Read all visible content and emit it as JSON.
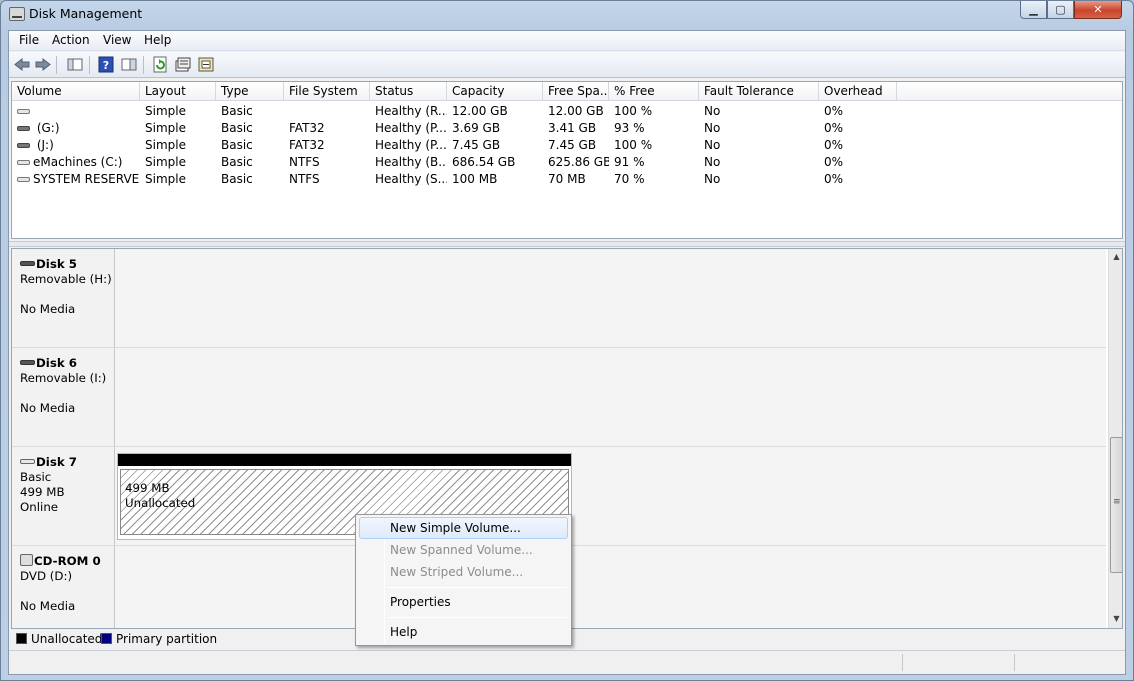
{
  "window": {
    "title": "Disk Management",
    "min_label": "▁",
    "max_label": "▢",
    "close_label": "✕"
  },
  "menu": [
    "File",
    "Action",
    "View",
    "Help"
  ],
  "toolbar": {
    "icons": [
      "back-icon",
      "forward-icon",
      "show-hide-console-tree-icon",
      "help-icon",
      "show-hide-action-pane-icon",
      "refresh-icon",
      "properties-icon",
      "rescan-disks-icon"
    ]
  },
  "volume_list": {
    "columns": [
      "Volume",
      "Layout",
      "Type",
      "File System",
      "Status",
      "Capacity",
      "Free Spa...",
      "% Free",
      "Fault Tolerance",
      "Overhead"
    ],
    "rows": [
      {
        "volume": "",
        "layout": "Simple",
        "type": "Basic",
        "fs": "",
        "status": "Healthy (R...",
        "capacity": "12.00 GB",
        "free": "12.00 GB",
        "pct": "100 %",
        "fault": "No",
        "overhead": "0%"
      },
      {
        "volume": "(G:)",
        "layout": "Simple",
        "type": "Basic",
        "fs": "FAT32",
        "status": "Healthy (P...",
        "capacity": "3.69 GB",
        "free": "3.41 GB",
        "pct": "93 %",
        "fault": "No",
        "overhead": "0%"
      },
      {
        "volume": "(J:)",
        "layout": "Simple",
        "type": "Basic",
        "fs": "FAT32",
        "status": "Healthy (P...",
        "capacity": "7.45 GB",
        "free": "7.45 GB",
        "pct": "100 %",
        "fault": "No",
        "overhead": "0%"
      },
      {
        "volume": "eMachines (C:)",
        "layout": "Simple",
        "type": "Basic",
        "fs": "NTFS",
        "status": "Healthy (B...",
        "capacity": "686.54 GB",
        "free": "625.86 GB",
        "pct": "91 %",
        "fault": "No",
        "overhead": "0%"
      },
      {
        "volume": "SYSTEM RESERVED",
        "layout": "Simple",
        "type": "Basic",
        "fs": "NTFS",
        "status": "Healthy (S...",
        "capacity": "100 MB",
        "free": "70 MB",
        "pct": "70 %",
        "fault": "No",
        "overhead": "0%"
      }
    ]
  },
  "disks": [
    {
      "name": "Disk 5",
      "line1": "Removable (H:)",
      "line2": "",
      "line3": "No Media"
    },
    {
      "name": "Disk 6",
      "line1": "Removable (I:)",
      "line2": "",
      "line3": "No Media"
    },
    {
      "name": "Disk 7",
      "line1": "Basic",
      "line2": "499 MB",
      "line3": "Online",
      "partition": {
        "size": "499 MB",
        "label": "Unallocated"
      }
    },
    {
      "name": "CD-ROM 0",
      "line1": "DVD (D:)",
      "line2": "",
      "line3": "No Media"
    }
  ],
  "legend": [
    {
      "label": "Unallocated",
      "color": "#000000"
    },
    {
      "label": "Primary partition",
      "color": "#000080"
    }
  ],
  "context_menu": {
    "items": [
      "New Simple Volume...",
      "New Spanned Volume...",
      "New Striped Volume...",
      "Properties",
      "Help"
    ]
  }
}
